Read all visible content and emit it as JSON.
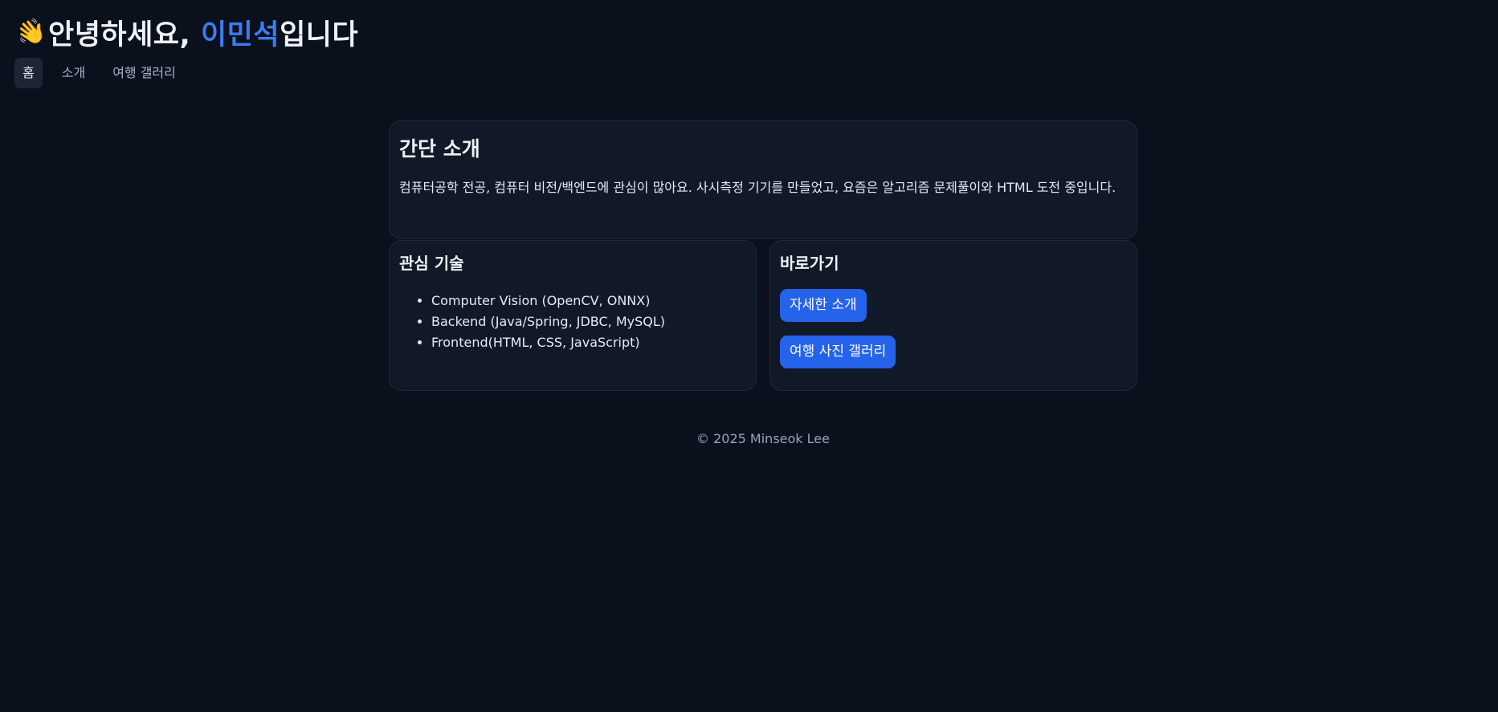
{
  "header": {
    "wave_icon": "👋",
    "title_prefix": "안녕하세요, ",
    "title_name": "이민석",
    "title_suffix": "입니다"
  },
  "nav": {
    "items": [
      {
        "label": "홈",
        "active": true
      },
      {
        "label": "소개",
        "active": false
      },
      {
        "label": "여행 갤러리",
        "active": false
      }
    ]
  },
  "intro": {
    "title": "간단 소개",
    "text": "컴퓨터공학 전공, 컴퓨터 비전/백엔드에 관심이 많아요. 사시측정 기기를 만들었고, 요즘은 알고리즘 문제풀이와 HTML 도전 중입니다."
  },
  "skills": {
    "title": "관심 기술",
    "items": [
      "Computer Vision (OpenCV, ONNX)",
      "Backend (Java/Spring, JDBC, MySQL)",
      "Frontend(HTML, CSS, JavaScript)"
    ]
  },
  "shortcuts": {
    "title": "바로가기",
    "about_button": "자세한 소개",
    "gallery_button": "여행 사진 갤러리"
  },
  "footer": {
    "text": "© 2025 Minseok Lee"
  },
  "colors": {
    "background": "#0a101c",
    "card": "#111827",
    "accent": "#2563eb",
    "name_highlight": "#3b7cf5"
  }
}
